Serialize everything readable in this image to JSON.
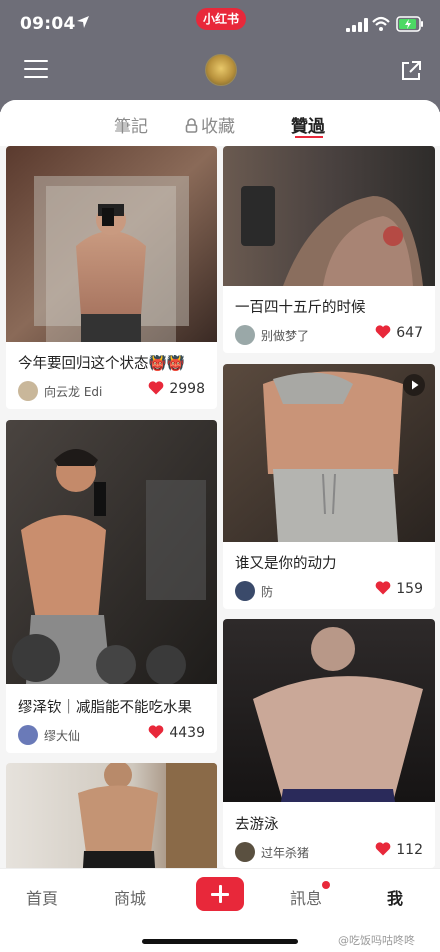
{
  "status_bar": {
    "time": "09:04",
    "app_badge": "小红书"
  },
  "tabs": [
    {
      "label": "筆記",
      "active": false
    },
    {
      "label": "收藏",
      "active": false,
      "locked": true
    },
    {
      "label": "贊過",
      "active": true
    }
  ],
  "cards": [
    {
      "title": "今年要回归这个状态👹👹",
      "author": "向云龙 Edi",
      "likes": "2998"
    },
    {
      "title": "一百四十五斤的时候",
      "author": "别做梦了",
      "likes": "647"
    },
    {
      "title": "缪泽钦｜减脂能不能吃水果",
      "author": "缪大仙",
      "likes": "4439"
    },
    {
      "title": "谁又是你的动力",
      "author": "防",
      "likes": "159"
    },
    {
      "title": "去游泳",
      "author": "过年杀猪",
      "likes": "112"
    }
  ],
  "bottom_nav": {
    "home": "首頁",
    "shop": "商城",
    "messages": "訊息",
    "me": "我"
  },
  "watermark": "@吃饭吗咕咚咚",
  "colors": {
    "brand_red": "#e8283a",
    "header_gray": "#6e6e78"
  }
}
